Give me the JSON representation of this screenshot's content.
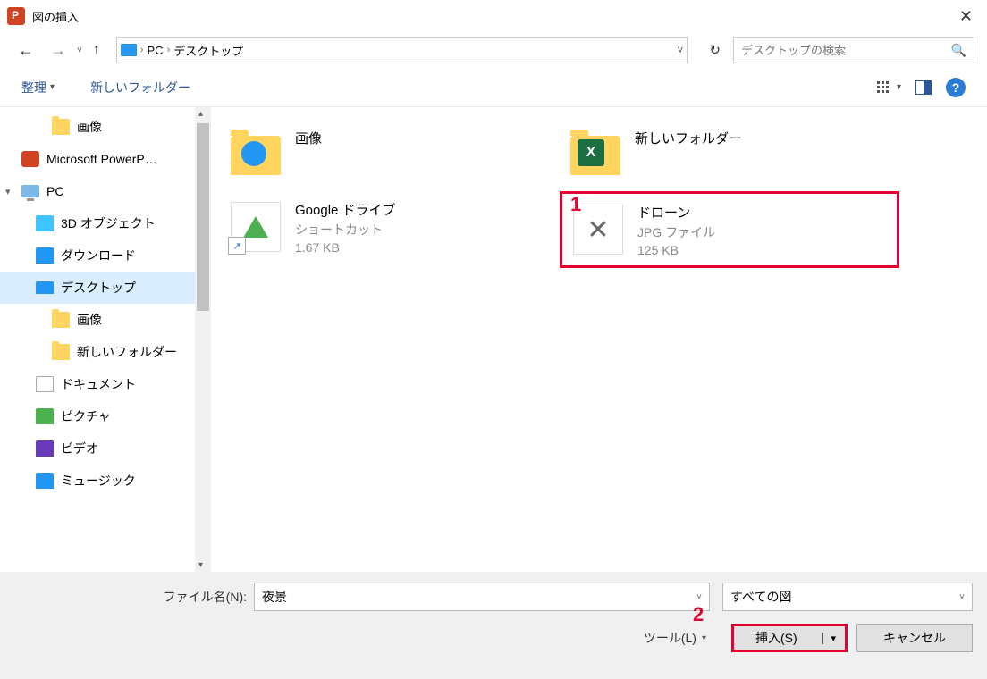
{
  "titlebar": {
    "title": "図の挿入"
  },
  "breadcrumb": {
    "root": "PC",
    "folder": "デスクトップ"
  },
  "search": {
    "placeholder": "デスクトップの検索"
  },
  "toolbar": {
    "organize": "整理",
    "newfolder": "新しいフォルダー"
  },
  "sidebar": {
    "items": [
      {
        "label": "画像",
        "icon": "folder",
        "lv": 3
      },
      {
        "label": "Microsoft PowerP…",
        "icon": "app",
        "lv": 1
      },
      {
        "label": "PC",
        "icon": "pc",
        "lv": 1,
        "caret": "▾"
      },
      {
        "label": "3D オブジェクト",
        "icon": "cube",
        "lv": 2
      },
      {
        "label": "ダウンロード",
        "icon": "dl",
        "lv": 2
      },
      {
        "label": "デスクトップ",
        "icon": "desktop",
        "lv": 2,
        "selected": true
      },
      {
        "label": "画像",
        "icon": "folder",
        "lv": 3
      },
      {
        "label": "新しいフォルダー",
        "icon": "folder",
        "lv": 3
      },
      {
        "label": "ドキュメント",
        "icon": "doc",
        "lv": 2
      },
      {
        "label": "ピクチャ",
        "icon": "pic",
        "lv": 2
      },
      {
        "label": "ビデオ",
        "icon": "vid",
        "lv": 2
      },
      {
        "label": "ミュージック",
        "icon": "music",
        "lv": 2
      }
    ]
  },
  "files": [
    {
      "name": "画像",
      "thumb": "folder-blue"
    },
    {
      "name": "新しいフォルダー",
      "thumb": "folder-excel"
    },
    {
      "name": "Google ドライブ",
      "meta1": "ショートカット",
      "meta2": "1.67 KB",
      "thumb": "drive-shortcut"
    },
    {
      "name": "ドローン",
      "meta1": "JPG ファイル",
      "meta2": "125 KB",
      "thumb": "drone",
      "highlight": true
    }
  ],
  "callouts": {
    "c1": "1",
    "c2": "2"
  },
  "bottom": {
    "filename_label": "ファイル名(N):",
    "filename_value": "夜景",
    "filetype": "すべての図",
    "tools": "ツール(L)",
    "insert": "挿入(S)",
    "cancel": "キャンセル"
  }
}
